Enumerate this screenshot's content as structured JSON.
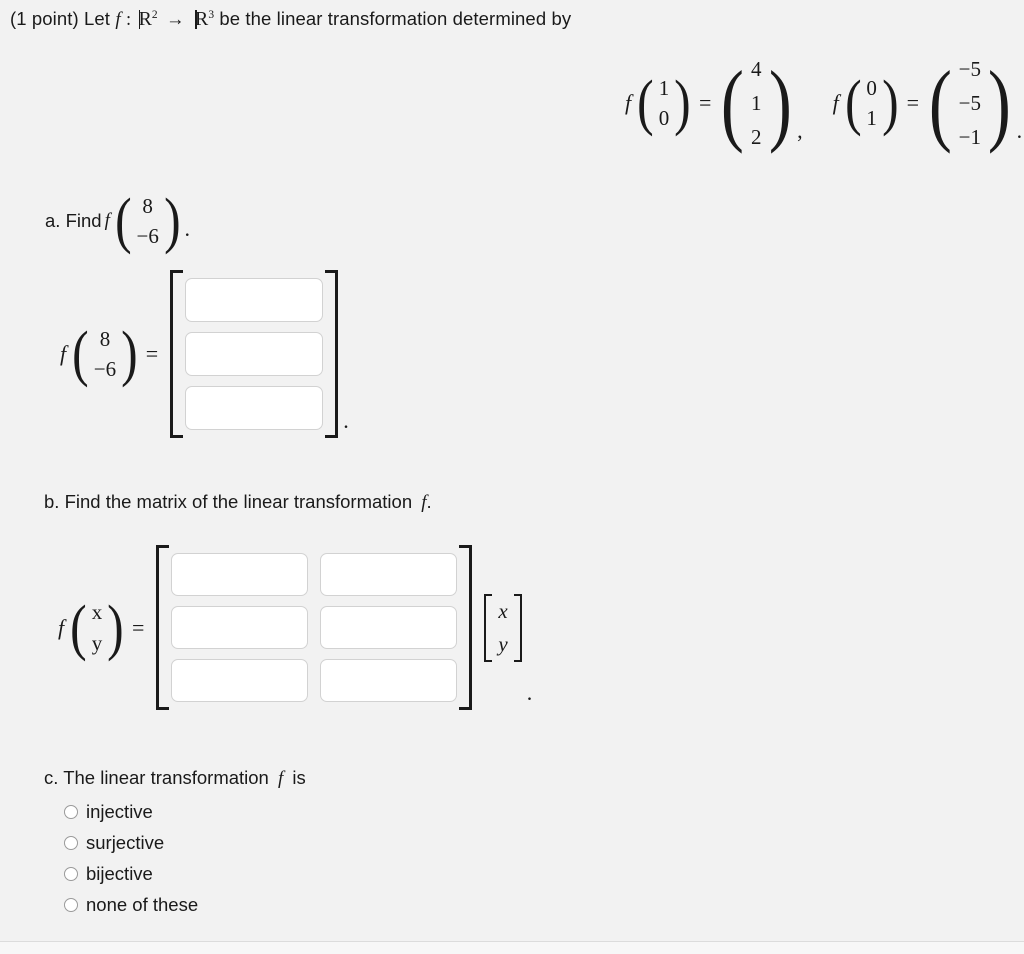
{
  "prompt": {
    "points": "(1 point)",
    "let": "Let",
    "f": "f",
    "colon": ":",
    "domain_base": "R",
    "domain_exp": "2",
    "arrow": "→",
    "codomain_base": "R",
    "codomain_exp": "3",
    "tail": "be the linear transformation determined by"
  },
  "given": {
    "equations": [
      {
        "f": "f",
        "input": [
          "1",
          "0"
        ],
        "equals": "=",
        "output": [
          "4",
          "1",
          "2"
        ],
        "punct": ","
      },
      {
        "f": "f",
        "input": [
          "0",
          "1"
        ],
        "equals": "=",
        "output": [
          "−5",
          "−5",
          "−1"
        ],
        "punct": "."
      }
    ]
  },
  "part_a": {
    "label_prefix": "a. Find",
    "f": "f",
    "vector": [
      "8",
      "−6"
    ],
    "label_suffix": ".",
    "answer": {
      "f": "f",
      "input": [
        "8",
        "−6"
      ],
      "equals": "=",
      "cells": [
        {
          "value": "",
          "placeholder": ""
        },
        {
          "value": "",
          "placeholder": ""
        },
        {
          "value": "",
          "placeholder": ""
        }
      ],
      "trailing": "."
    }
  },
  "part_b": {
    "label": "b. Find the matrix of the linear transformation",
    "f": "f",
    "label_suffix": ".",
    "answer": {
      "f": "f",
      "input": [
        "x",
        "y"
      ],
      "equals": "=",
      "rows": [
        [
          {
            "value": "",
            "placeholder": ""
          },
          {
            "value": "",
            "placeholder": ""
          }
        ],
        [
          {
            "value": "",
            "placeholder": ""
          },
          {
            "value": "",
            "placeholder": ""
          }
        ],
        [
          {
            "value": "",
            "placeholder": ""
          },
          {
            "value": "",
            "placeholder": ""
          }
        ]
      ],
      "xy_vector": [
        "x",
        "y"
      ],
      "trailing": "."
    }
  },
  "part_c": {
    "label_prefix": "c. The linear transformation",
    "f": "f",
    "label_suffix": "is",
    "choices": [
      {
        "label": "injective",
        "selected": false
      },
      {
        "label": "surjective",
        "selected": false
      },
      {
        "label": "bijective",
        "selected": false
      },
      {
        "label": "none of these",
        "selected": false
      }
    ]
  },
  "colors": {
    "background": "#f2f2f2",
    "text": "#1a1a1a",
    "input_border": "#d2d2d2",
    "input_fill": "#ffffff",
    "radio_border": "#9a9a9a",
    "divider": "#dcdcdc"
  },
  "symbols": {
    "paren_left": "(",
    "paren_right": ")"
  }
}
